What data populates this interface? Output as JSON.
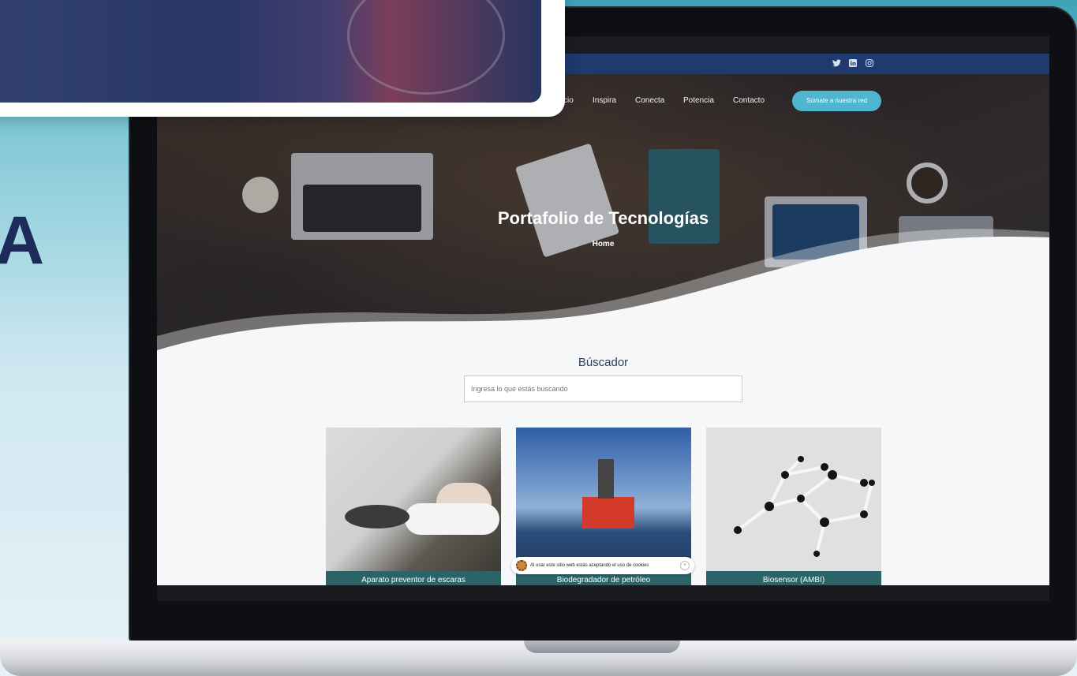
{
  "left_fragment": {
    "letter": "A"
  },
  "site": {
    "social_icons": [
      "twitter-icon",
      "linkedin-icon",
      "instagram-icon"
    ],
    "nav": {
      "partial_item": "cio",
      "items": [
        "Inspira",
        "Conecta",
        "Potencia",
        "Contacto"
      ],
      "cta": "Súmate a nuestra red"
    },
    "hero": {
      "title": "Portafolio de Tecnologías",
      "breadcrumb": "Home"
    },
    "search": {
      "title": "Búscador",
      "placeholder": "Ingresa lo que estás buscando"
    },
    "cards": [
      {
        "label": "Aparato preventor de escaras"
      },
      {
        "label": "Biodegradador de petróleo"
      },
      {
        "label": "Biosensor (AMBI)"
      }
    ],
    "cookie_notice": "Al usar este sitio web estás aceptando el uso de cookies",
    "cookie_close": "×"
  },
  "colors": {
    "top_strip": "#1f3a6e",
    "cta": "#4fb6cf",
    "card_label": "#2b6468"
  }
}
